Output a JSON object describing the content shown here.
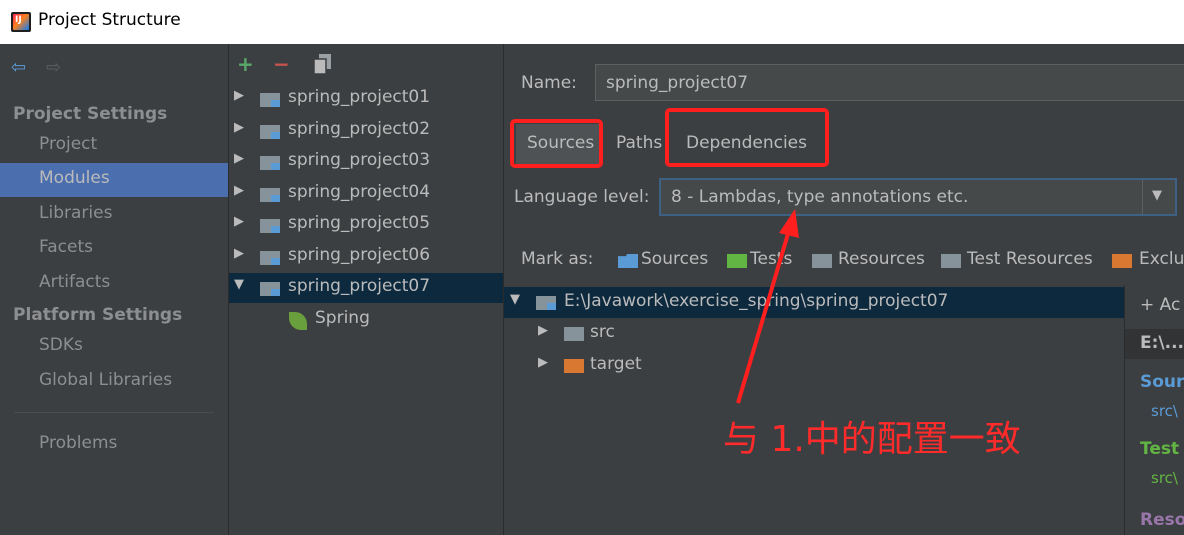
{
  "window": {
    "title": "Project Structure"
  },
  "left_nav": {
    "back_icon": "arrow-left-icon",
    "forward_icon": "arrow-right-icon",
    "project_settings_header": "Project Settings",
    "project_settings_items": [
      "Project",
      "Modules",
      "Libraries",
      "Facets",
      "Artifacts"
    ],
    "platform_settings_header": "Platform Settings",
    "platform_settings_items": [
      "SDKs",
      "Global Libraries"
    ],
    "problems": "Problems",
    "selected": "Modules"
  },
  "modules_panel": {
    "toolbar": {
      "add": "+",
      "remove": "−",
      "copy_icon": "copy-icon"
    },
    "modules": [
      "spring_project01",
      "spring_project02",
      "spring_project03",
      "spring_project04",
      "spring_project05",
      "spring_project06",
      "spring_project07"
    ],
    "expanded_module": "spring_project07",
    "child": "Spring"
  },
  "details": {
    "name_label": "Name:",
    "name_value": "spring_project07",
    "tabs": [
      "Sources",
      "Paths",
      "Dependencies"
    ],
    "active_tab": "Sources",
    "language_level_label": "Language level:",
    "language_level_value": "8 - Lambdas, type annotations etc.",
    "mark_as_label": "Mark as:",
    "mark_as_items": [
      "Sources",
      "Tests",
      "Resources",
      "Test Resources",
      "Exclu"
    ],
    "content_root": "E:\\Javawork\\exercise_spring\\spring_project07",
    "children": [
      "src",
      "target"
    ],
    "side_panel": {
      "add": "+ Ac",
      "path": "E:\\...e",
      "sources_header": "Sour",
      "sources_path": "src\\",
      "test_header": "Test",
      "test_path": "src\\",
      "resources_header": "Reso"
    }
  },
  "annotation": {
    "text": "与 1.中的配置一致",
    "color": "#ff2a2a"
  },
  "colors": {
    "background": "#3c3f41",
    "selection": "#4b6eaf",
    "tree_selection": "#0d293e",
    "text": "#bbbbbb",
    "highlight": "#ff1f1f",
    "add_green": "#59a869",
    "remove_red": "#c75450"
  }
}
